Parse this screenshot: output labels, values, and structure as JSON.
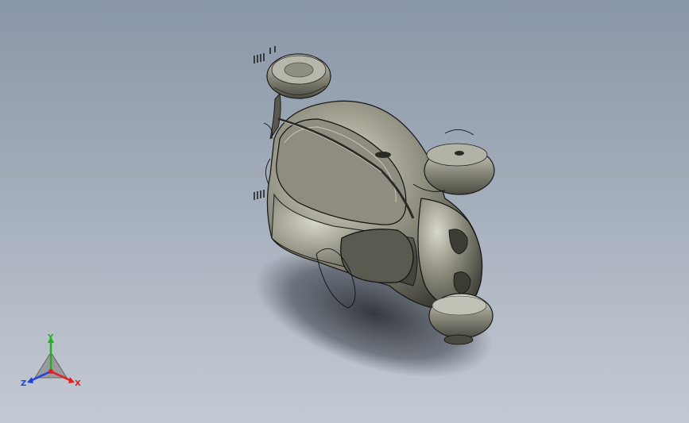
{
  "viewport": {
    "background_top": "#8a97a8",
    "background_bottom": "#c4cad3",
    "model_name": ""
  },
  "colors": {
    "body_fill": "#7d7c6e",
    "body_light": "#c9c8bc",
    "body_dark": "#3e3e36",
    "edge": "#1a1a1a",
    "shadow": "#2a2e36"
  },
  "triad": {
    "x_label": "X",
    "y_label": "Y",
    "z_label": "Z",
    "x_color": "#e02020",
    "y_color": "#20b020",
    "z_color": "#2040e0"
  }
}
